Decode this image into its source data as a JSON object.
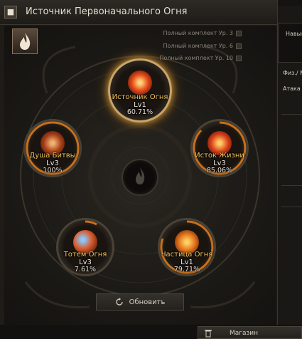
{
  "window": {
    "title": "Источник Первоначального Огня"
  },
  "sets": [
    {
      "label": "Полный комплект Ур. 3"
    },
    {
      "label": "Полный комплект Ур. 6"
    },
    {
      "label": "Полный комплект Ур. 10"
    }
  ],
  "nodes": {
    "main": {
      "name": "Источник Огня",
      "level": "Lv1",
      "progress": "60.71%"
    },
    "left": {
      "name": "Душа Битвы",
      "level": "Lv3",
      "progress": "100%"
    },
    "right": {
      "name": "Исток Жизни",
      "level": "Lv3",
      "progress": "85.06%"
    },
    "bottom_left": {
      "name": "Тотем Огня",
      "level": "Lv3",
      "progress": "7.61%"
    },
    "bottom_right": {
      "name": "Частица Огня",
      "level": "Lv1",
      "progress": "79.71%"
    }
  },
  "buttons": {
    "refresh": "Обновить",
    "shop": "Магазин"
  },
  "right_panel": {
    "tab": "Навык",
    "stat1": "Физ./ М",
    "stat2": "Атака с"
  },
  "colors": {
    "accent_gold": "#f2c55a",
    "ring_orange": "#e07a1a"
  },
  "icons": [
    "flame-icon",
    "refresh-icon",
    "trash-icon",
    "window-icon"
  ]
}
